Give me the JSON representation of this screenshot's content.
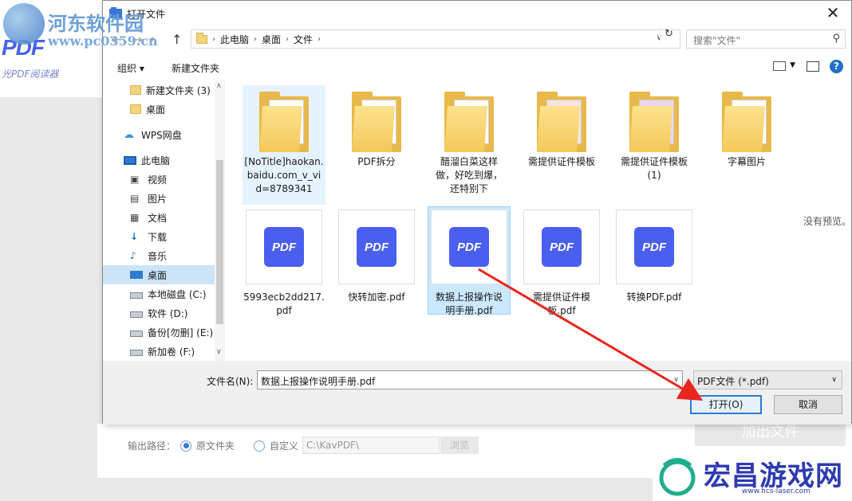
{
  "background_app": {
    "logo": "PDF",
    "logo_sub": "光PDF阅读器",
    "output_label": "输出路径：",
    "radio_original": "原文件夹",
    "radio_custom": "自定义",
    "path_value": "C:\\KavPDF\\",
    "browse": "浏览",
    "add_button": "加出文件"
  },
  "watermark_tl": {
    "line1": "河东软件园",
    "line2": "www.pc0359.cn"
  },
  "watermark_br": {
    "line1": "宏昌游戏网",
    "line2": "www.hcs-laser.com"
  },
  "dialog": {
    "title": "打开文件",
    "breadcrumb": [
      "此电脑",
      "桌面",
      "文件"
    ],
    "search_placeholder": "搜索\"文件\"",
    "toolbar": {
      "organize": "组织 ▾",
      "new_folder": "新建文件夹"
    },
    "sidebar": [
      {
        "label": "新建文件夹 (3)",
        "icon": "folder-icon"
      },
      {
        "label": "桌面",
        "icon": "folder-icon"
      },
      {
        "label": "WPS网盘",
        "icon": "cloud-icon"
      },
      {
        "label": "此电脑",
        "icon": "pc-icon"
      },
      {
        "label": "视频",
        "icon": "video-icon"
      },
      {
        "label": "图片",
        "icon": "picture-icon"
      },
      {
        "label": "文档",
        "icon": "document-icon"
      },
      {
        "label": "下载",
        "icon": "download-icon"
      },
      {
        "label": "音乐",
        "icon": "music-icon"
      },
      {
        "label": "桌面",
        "icon": "desktop-icon"
      },
      {
        "label": "本地磁盘 (C:)",
        "icon": "drive-icon"
      },
      {
        "label": "软件 (D:)",
        "icon": "drive-icon"
      },
      {
        "label": "备份[勿删] (E:)",
        "icon": "drive-icon"
      },
      {
        "label": "新加卷 (F:)",
        "icon": "drive-icon"
      }
    ],
    "files": [
      {
        "name": "[NoTitle]haokan.baidu.com_v_vid=8789341",
        "kind": "folder"
      },
      {
        "name": "PDF拆分",
        "kind": "folder"
      },
      {
        "name": "醋溜白菜这样做，好吃到爆，还特别下",
        "kind": "folder"
      },
      {
        "name": "需提供证件模板",
        "kind": "folder"
      },
      {
        "name": "需提供证件模板 (1)",
        "kind": "folder"
      },
      {
        "name": "字幕图片",
        "kind": "folder"
      },
      {
        "name": "5993ecb2dd217.pdf",
        "kind": "pdf"
      },
      {
        "name": "快转加密.pdf",
        "kind": "pdf"
      },
      {
        "name": "数据上报操作说明手册.pdf",
        "kind": "pdf"
      },
      {
        "name": "需提供证件模板.pdf",
        "kind": "pdf"
      },
      {
        "name": "转换PDF.pdf",
        "kind": "pdf"
      }
    ],
    "pdf_icon_text": "PDF",
    "preview_text": "没有预览。",
    "filename_label": "文件名(N):",
    "filename_value": "数据上报操作说明手册.pdf",
    "filetype": "PDF文件 (*.pdf)",
    "open_button": "打开(O)",
    "cancel_button": "取消"
  },
  "colors": {
    "accent": "#2f7bd1",
    "pdf_icon": "#4a5ff0",
    "annotation_arrow": "#e8261f"
  }
}
